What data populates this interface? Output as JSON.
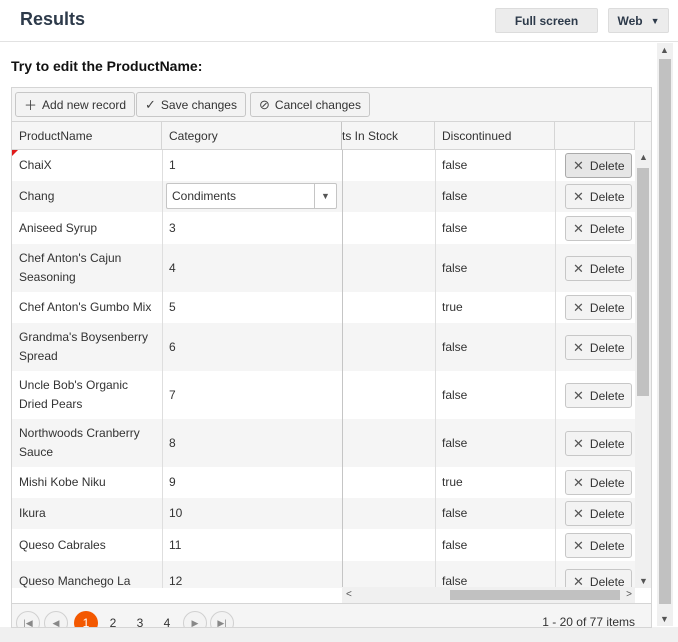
{
  "header": {
    "title": "Results",
    "fullscreen_label": "Full screen",
    "web_label": "Web"
  },
  "instruction": "Try to edit the ProductName:",
  "toolbar": {
    "add_label": "Add new record",
    "save_label": "Save changes",
    "cancel_label": "Cancel changes"
  },
  "columns": {
    "product": "ProductName",
    "category": "Category",
    "stock": "ts In Stock",
    "discontinued": "Discontinued"
  },
  "delete_label": "Delete",
  "dropdown_value": "Condiments",
  "rows": [
    {
      "name": "ChaiX",
      "category": "1",
      "discontinued": "false"
    },
    {
      "name": "Chang",
      "category": "",
      "discontinued": "false"
    },
    {
      "name": "Aniseed Syrup",
      "category": "3",
      "discontinued": "false"
    },
    {
      "name": "Chef Anton's Cajun Seasoning",
      "category": "4",
      "discontinued": "false"
    },
    {
      "name": "Chef Anton's Gumbo Mix",
      "category": "5",
      "discontinued": "true"
    },
    {
      "name": "Grandma's Boysenberry Spread",
      "category": "6",
      "discontinued": "false"
    },
    {
      "name": "Uncle Bob's Organic Dried Pears",
      "category": "7",
      "discontinued": "false"
    },
    {
      "name": "Northwoods Cranberry Sauce",
      "category": "8",
      "discontinued": "false"
    },
    {
      "name": "Mishi Kobe Niku",
      "category": "9",
      "discontinued": "true"
    },
    {
      "name": "Ikura",
      "category": "10",
      "discontinued": "false"
    },
    {
      "name": "Queso Cabrales",
      "category": "11",
      "discontinued": "false"
    },
    {
      "name": "Queso Manchego La",
      "category": "12",
      "discontinued": "false"
    }
  ],
  "pager": {
    "pages": [
      "1",
      "2",
      "3",
      "4"
    ],
    "current_page": "1",
    "info": "1 - 20 of 77 items"
  }
}
